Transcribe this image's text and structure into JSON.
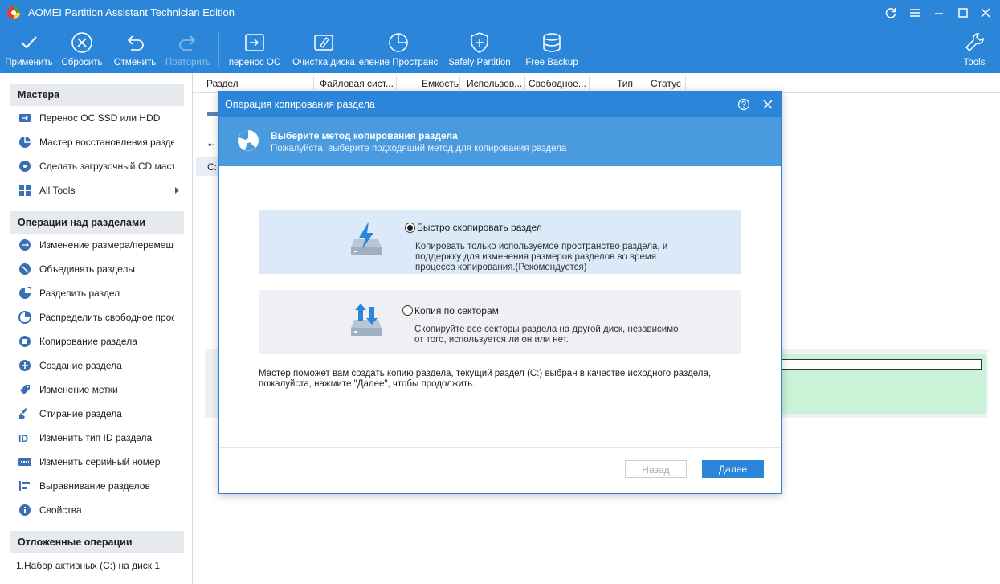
{
  "window": {
    "title": "AOMEI Partition Assistant Technician Edition"
  },
  "toolbar": {
    "apply": "Применить",
    "discard": "Сбросить",
    "undo": "Отменить",
    "redo": "Повторить",
    "migrate_os": "перенос ОС",
    "wipe_disk": "Очистка диска",
    "allocate_space": "еление Пространс",
    "safely_partition": "Safely Partition",
    "free_backup": "Free Backup",
    "tools": "Tools"
  },
  "sidebar": {
    "wizards_title": "Мастера",
    "wizards": [
      {
        "label": "Перенос ОС SSD или HDD",
        "icon": "migrate-icon"
      },
      {
        "label": "Мастер восстановления раздела",
        "icon": "recovery-icon"
      },
      {
        "label": "Сделать загрузочный CD мастер",
        "icon": "bootable-cd-icon"
      },
      {
        "label": "All Tools",
        "icon": "all-tools-icon"
      }
    ],
    "operations_title": "Операции над разделами",
    "operations": [
      {
        "label": "Изменение размера/перемеще...",
        "icon": "resize-icon"
      },
      {
        "label": "Объединять разделы",
        "icon": "merge-icon"
      },
      {
        "label": "Разделить раздел",
        "icon": "split-icon"
      },
      {
        "label": "Распределить свободное прос...",
        "icon": "allocate-icon"
      },
      {
        "label": "Копирование раздела",
        "icon": "copy-icon"
      },
      {
        "label": "Создание раздела",
        "icon": "create-icon"
      },
      {
        "label": "Изменение метки",
        "icon": "label-icon"
      },
      {
        "label": "Стирание раздела",
        "icon": "wipe-icon"
      },
      {
        "label": "Изменить тип ID раздела",
        "icon": "id-icon"
      },
      {
        "label": "Изменить серийный номер",
        "icon": "serial-icon"
      },
      {
        "label": "Выравнивание разделов",
        "icon": "align-icon"
      },
      {
        "label": "Свойства",
        "icon": "info-icon"
      }
    ],
    "pending_title": "Отложенные операции",
    "pending": [
      {
        "label": "1.Набор активных (C:) на диск 1"
      }
    ]
  },
  "table": {
    "columns": [
      "Раздел",
      "Файловая сист...",
      "Емкость",
      "Использов...",
      "Свободное...",
      "Тип",
      "Статус"
    ],
    "row_star": "*:",
    "row_c": "C:"
  },
  "dialog": {
    "title": "Операция копирования раздела",
    "header_title": "Выберите метод копирования раздела",
    "header_subtitle": "Пожалуйста, выберите подходящий метод для копирования раздела",
    "option_fast": {
      "title": "Быстро скопировать раздел",
      "desc_line1": "Копировать только используемое пространство раздела, и",
      "desc_line2": "поддержку для изменения размеров разделов во время",
      "desc_line3": "процесса копирования.(Рекомендуется)",
      "selected": true
    },
    "option_sector": {
      "title": "Копия по секторам",
      "desc_line1": "Скопируйте все секторы раздела на другой диск, независимо",
      "desc_line2": "от того, используется ли он или нет.",
      "selected": false
    },
    "note_line1": "Мастер поможет вам создать копию раздела, текущий раздел (C:) выбран в качестве исходного раздела,",
    "note_line2": "пожалуйста, нажмите \"Далее\", чтобы продолжить.",
    "back_label": "Назад",
    "next_label": "Далее"
  }
}
